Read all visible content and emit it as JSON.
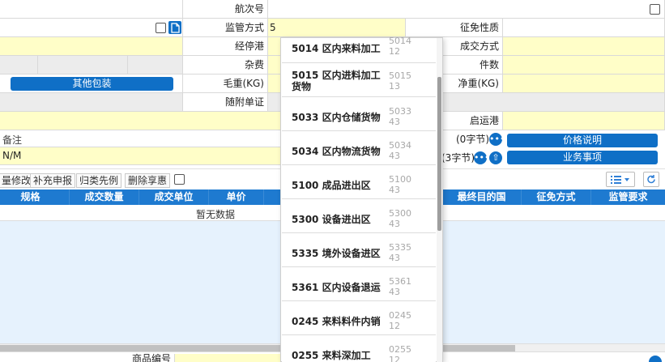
{
  "form": {
    "voyage_label": "航次号",
    "supervision_label": "监管方式",
    "supervision_value": "5",
    "exemption_nature_label": "征免性质",
    "port_via_label": "经停港",
    "transaction_mode_label": "成交方式",
    "misc_fee_label": "杂费",
    "pieces_label": "件数",
    "other_packaging_button": "其他包装",
    "gross_weight_label": "毛重(KG)",
    "net_weight_label": "净重(KG)",
    "attached_docs_label": "随附单证",
    "departure_port_label": "启运港",
    "remarks_label": "备注",
    "remarks_value": "N/M",
    "counter1": "(0字节)",
    "counter2": "(3字节)",
    "price_note_button": "价格说明",
    "business_items_button": "业务事项"
  },
  "toolbar": {
    "batch_modify": "量修改",
    "supplement_report": "补充申报",
    "classify_precedent": "归类先例",
    "delete_benefit": "删除享惠"
  },
  "table": {
    "headers": [
      "规格",
      "成交数量",
      "成交单位",
      "单价",
      "最终目的国",
      "征免方式",
      "监管要求"
    ],
    "empty_text": "暂无数据"
  },
  "footer": {
    "partial_label": "商品编号"
  },
  "dropdown": {
    "items": [
      {
        "name": "5014 区内来料加工",
        "code": "5014 12"
      },
      {
        "name": "5015 区内进料加工货物",
        "code": "5015 13"
      },
      {
        "name": "5033 区内仓储货物",
        "code": "5033 43"
      },
      {
        "name": "5034 区内物流货物",
        "code": "5034 43"
      },
      {
        "name": "5100 成品进出区",
        "code": "5100 43"
      },
      {
        "name": "5300 设备进出区",
        "code": "5300 43"
      },
      {
        "name": "5335 境外设备进区",
        "code": "5335 43"
      },
      {
        "name": "5361 区内设备退运",
        "code": "5361 43"
      },
      {
        "name": "0245 来料料件内销",
        "code": "0245 12"
      },
      {
        "name": "0255 来料深加工",
        "code": "0255 12"
      }
    ]
  },
  "colors": {
    "field_yellow": "#fffec8",
    "header_blue": "#1e7ad0",
    "button_blue": "#0f6fc6",
    "grid_bg": "#e6f2fd"
  }
}
